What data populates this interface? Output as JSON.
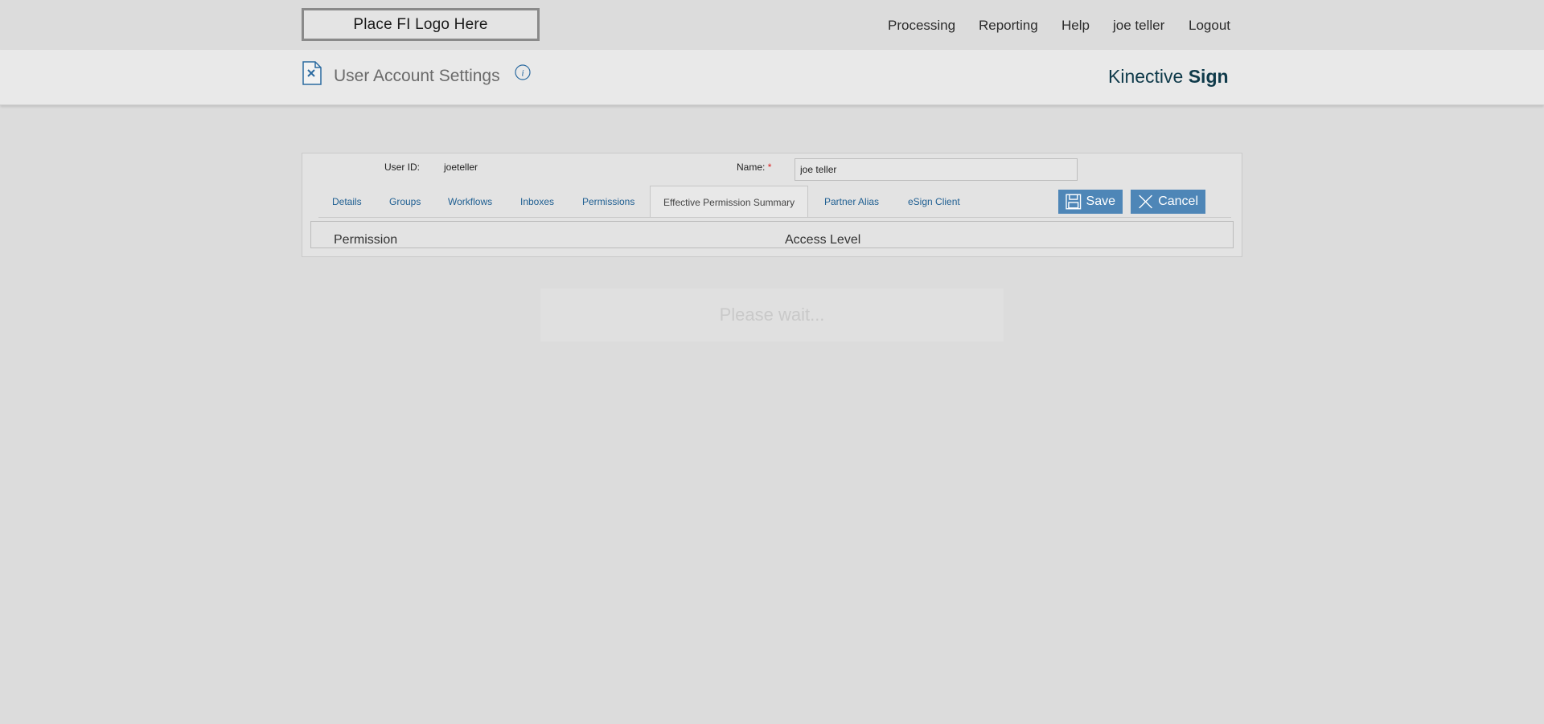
{
  "topbar": {
    "logo_text": "Place FI Logo Here",
    "nav": [
      "Processing",
      "Reporting",
      "Help",
      "joe teller",
      "Logout"
    ]
  },
  "header": {
    "title": "User Account Settings",
    "brand_regular": "Kinective ",
    "brand_bold": "Sign"
  },
  "form": {
    "user_id_label": "User ID:",
    "user_id_value": "joeteller",
    "name_label": "Name:",
    "name_required": "*",
    "name_value": "joe teller"
  },
  "tabs": [
    "Details",
    "Groups",
    "Workflows",
    "Inboxes",
    "Permissions",
    "Effective Permission Summary",
    "Partner Alias",
    "eSign Client"
  ],
  "active_tab": "Effective Permission Summary",
  "buttons": {
    "save": "Save",
    "cancel": "Cancel"
  },
  "grid": {
    "columns": [
      "Permission",
      "Access Level"
    ]
  },
  "overlay": {
    "message": "Please wait..."
  },
  "colors": {
    "button": "#4e86b7",
    "link": "#1f5f92",
    "brand": "#0f3a4a",
    "required": "#dd2222"
  }
}
